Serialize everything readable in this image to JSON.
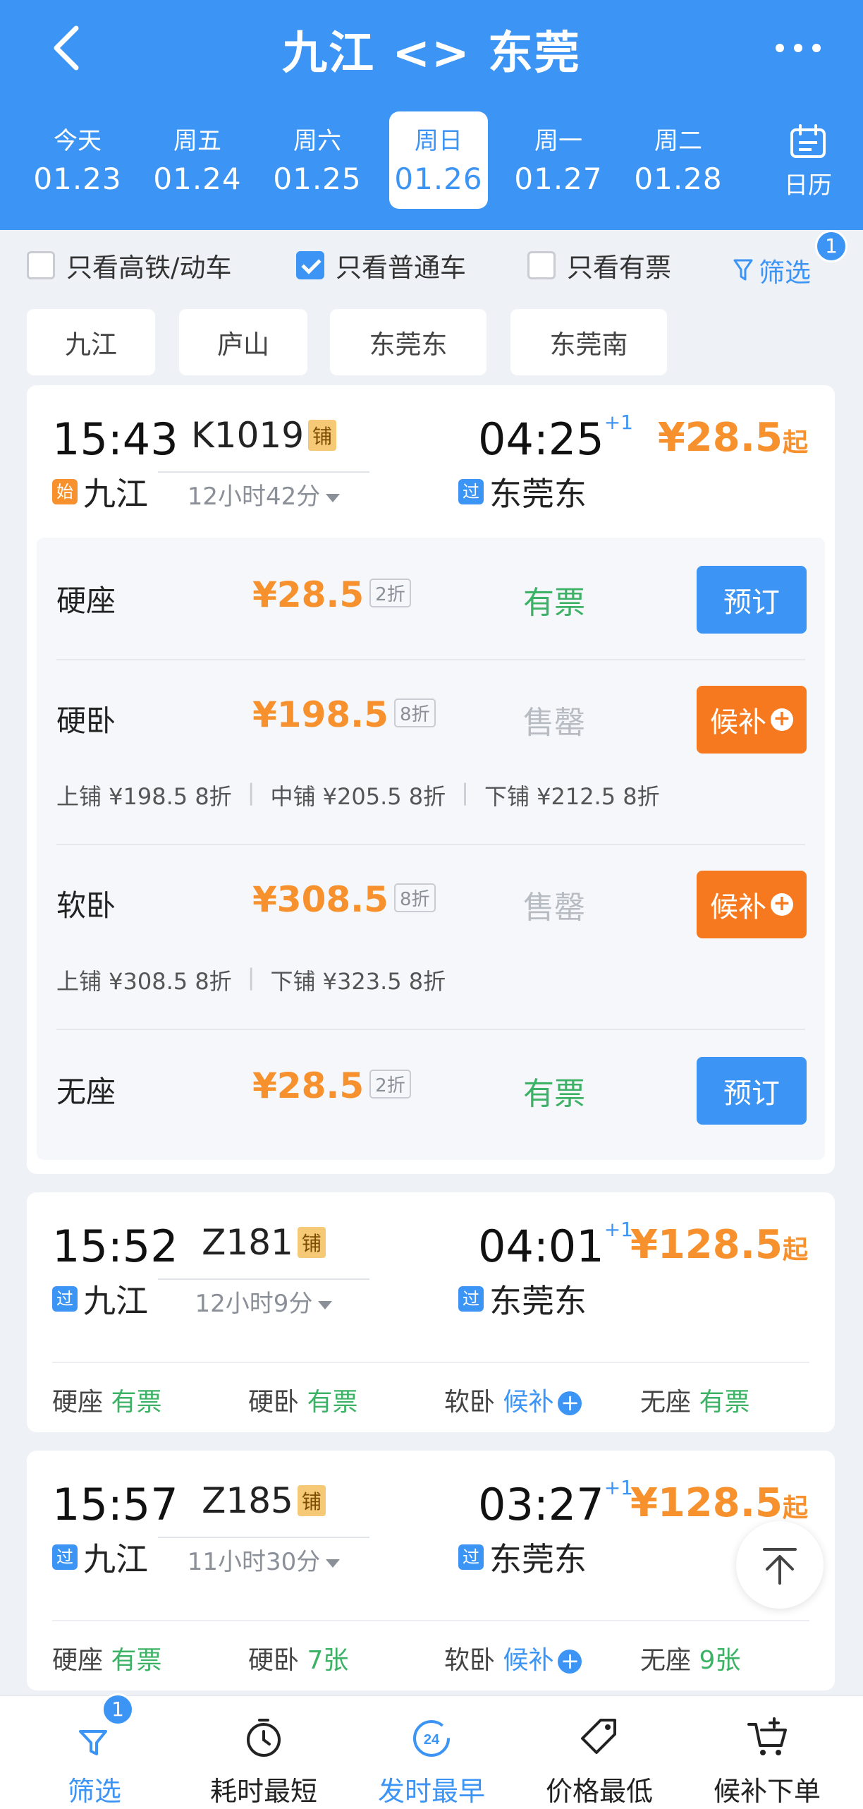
{
  "header": {
    "title": "九江 <> 东莞",
    "dates": [
      {
        "week": "今天",
        "date": "01.23",
        "selected": false
      },
      {
        "week": "周五",
        "date": "01.24",
        "selected": false
      },
      {
        "week": "周六",
        "date": "01.25",
        "selected": false
      },
      {
        "week": "周日",
        "date": "01.26",
        "selected": true
      },
      {
        "week": "周一",
        "date": "01.27",
        "selected": false
      },
      {
        "week": "周二",
        "date": "01.28",
        "selected": false
      }
    ],
    "calendar_label": "日历"
  },
  "filters": {
    "gaotie": {
      "label": "只看高铁/动车",
      "checked": false
    },
    "putong": {
      "label": "只看普通车",
      "checked": true
    },
    "youpiao": {
      "label": "只看有票",
      "checked": false
    },
    "filter_label": "筛选",
    "filter_count": "1"
  },
  "stations": [
    "九江",
    "庐山",
    "东莞东",
    "东莞南"
  ],
  "trains": [
    {
      "dep_time": "15:43",
      "dep_tag": "始",
      "dep_station": "九江",
      "train_no": "K1019",
      "berth_tag": "铺",
      "duration": "12小时42分",
      "arr_time": "04:25",
      "arr_plus": "+1",
      "arr_tag": "过",
      "arr_station": "东莞东",
      "price": "¥28.5",
      "price_suffix": "起",
      "seats": [
        {
          "name": "硬座",
          "price": "¥28.5",
          "discount": "2折",
          "status": "有票",
          "button": "预订"
        },
        {
          "name": "硬卧",
          "price": "¥198.5",
          "discount": "8折",
          "status": "售罄",
          "button": "候补",
          "details": [
            "上铺 ¥198.5 8折",
            "中铺 ¥205.5 8折",
            "下铺 ¥212.5 8折"
          ]
        },
        {
          "name": "软卧",
          "price": "¥308.5",
          "discount": "8折",
          "status": "售罄",
          "button": "候补",
          "details": [
            "上铺 ¥308.5 8折",
            "下铺 ¥323.5 8折"
          ]
        },
        {
          "name": "无座",
          "price": "¥28.5",
          "discount": "2折",
          "status": "有票",
          "button": "预订"
        }
      ]
    },
    {
      "dep_time": "15:52",
      "dep_tag": "过",
      "dep_station": "九江",
      "train_no": "Z181",
      "berth_tag": "铺",
      "duration": "12小时9分",
      "arr_time": "04:01",
      "arr_plus": "+1",
      "arr_tag": "过",
      "arr_station": "东莞东",
      "price": "¥128.5",
      "price_suffix": "起",
      "summary": [
        {
          "name": "硬座",
          "status": "有票"
        },
        {
          "name": "硬卧",
          "status": "有票"
        },
        {
          "name": "软卧",
          "status": "候补"
        },
        {
          "name": "无座",
          "status": "有票"
        }
      ]
    },
    {
      "dep_time": "15:57",
      "dep_tag": "过",
      "dep_station": "九江",
      "train_no": "Z185",
      "berth_tag": "铺",
      "duration": "11小时30分",
      "arr_time": "03:27",
      "arr_plus": "+1",
      "arr_tag": "过",
      "arr_station": "东莞东",
      "price": "¥128.5",
      "price_suffix": "起",
      "summary": [
        {
          "name": "硬座",
          "status": "有票"
        },
        {
          "name": "硬卧",
          "status": "7张"
        },
        {
          "name": "软卧",
          "status": "候补"
        },
        {
          "name": "无座",
          "status": "9张"
        }
      ]
    }
  ],
  "tabbar": [
    {
      "label": "筛选",
      "icon": "filter-icon",
      "badge": "1"
    },
    {
      "label": "耗时最短",
      "icon": "stopwatch-icon"
    },
    {
      "label": "发时最早",
      "icon": "clock-24-icon",
      "icon_text": "24"
    },
    {
      "label": "价格最低",
      "icon": "price-tag-icon"
    },
    {
      "label": "候补下单",
      "icon": "cart-icon"
    }
  ],
  "colors": {
    "primary": "#3c94f4",
    "orange": "#f7912e",
    "green": "#3db266",
    "grey": "#b7bbc2"
  }
}
